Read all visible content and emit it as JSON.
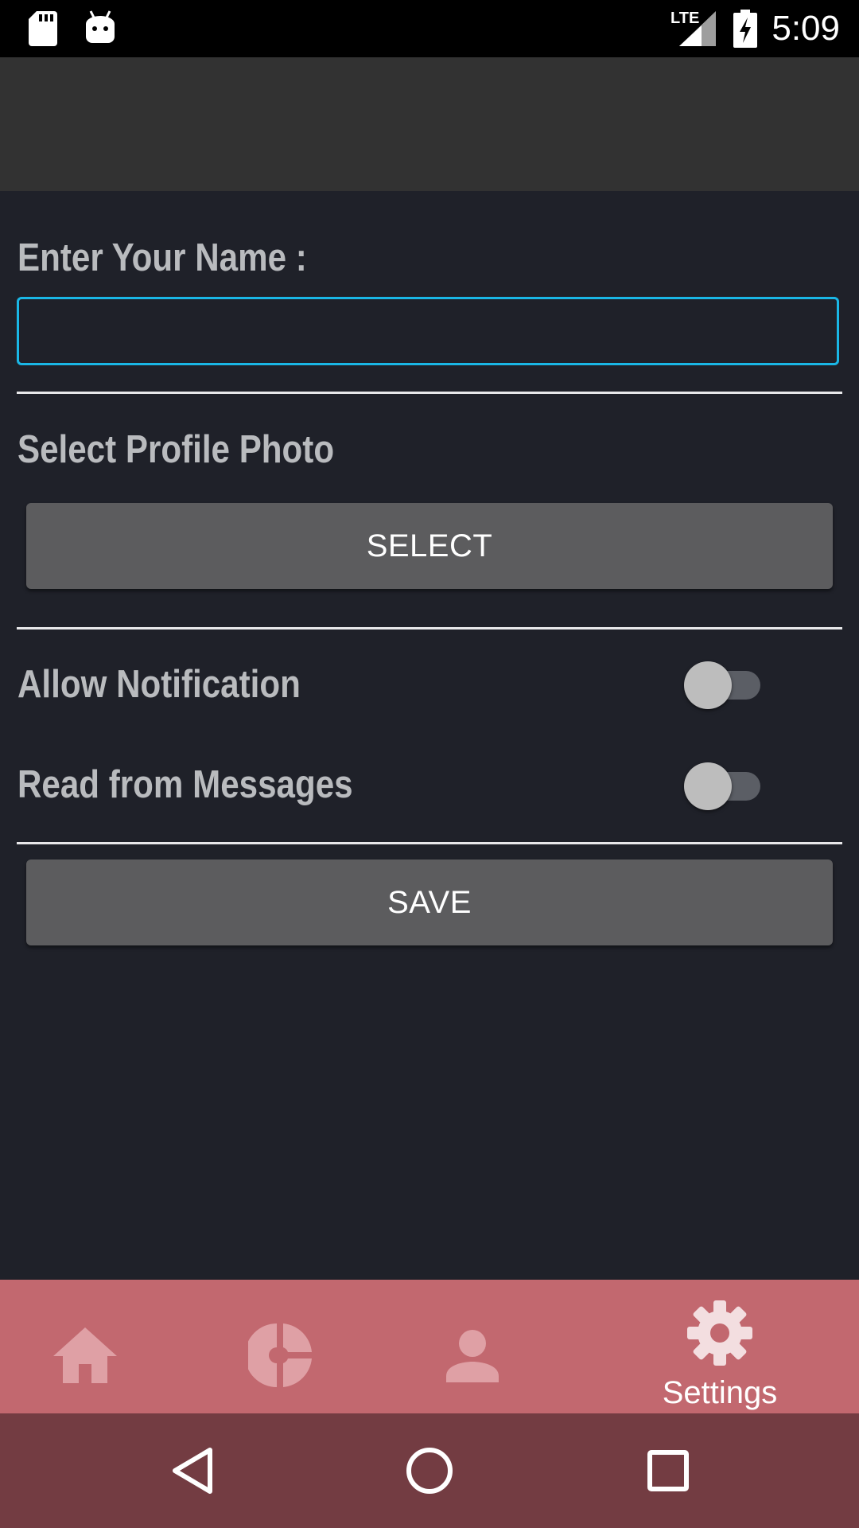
{
  "status_bar": {
    "time": "5:09",
    "network": "LTE",
    "icons": [
      "sd-card-icon",
      "android-debug-icon",
      "lte-signal-icon",
      "battery-charging-icon"
    ]
  },
  "form": {
    "name_label": "Enter Your Name :",
    "name_value": "",
    "photo_label": "Select Profile Photo",
    "select_button": "SELECT",
    "notification_label": "Allow Notification",
    "notification_on": false,
    "messages_label": "Read from Messages",
    "messages_on": false,
    "save_button": "SAVE"
  },
  "bottom_nav": {
    "items": [
      {
        "icon": "home-icon",
        "label": ""
      },
      {
        "icon": "pie-chart-icon",
        "label": ""
      },
      {
        "icon": "person-icon",
        "label": ""
      },
      {
        "icon": "gear-icon",
        "label": "Settings",
        "selected": true
      }
    ]
  },
  "colors": {
    "background": "#1f2129",
    "toolbar": "#323232",
    "accent": "#1ab7e6",
    "bottom_nav": "#c2686f",
    "system_nav": "#733c42"
  }
}
